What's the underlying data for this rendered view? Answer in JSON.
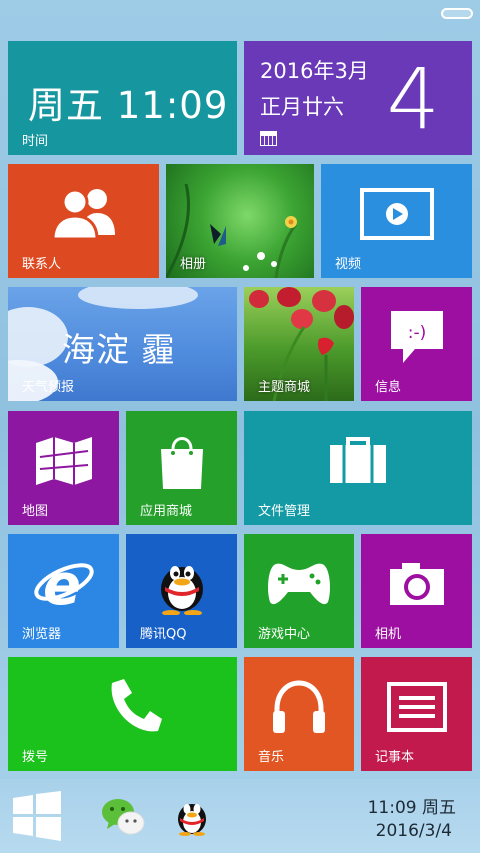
{
  "status_bar": {
    "battery_icon": "battery-icon"
  },
  "tiles": {
    "clock": {
      "time": "周五  11:09",
      "label": "时间",
      "color": "#16969e"
    },
    "calendar": {
      "line1": "2016年3月",
      "line2": "正月廿六",
      "day": "4",
      "icon": "calendar-icon",
      "color": "#6a39b8"
    },
    "contacts": {
      "label": "联系人",
      "icon": "contacts-icon",
      "color": "#dd4a22"
    },
    "album": {
      "label": "相册",
      "color": "#2f9a2a"
    },
    "video": {
      "label": "视频",
      "icon": "video-play-icon",
      "color": "#2a8fdf"
    },
    "weather": {
      "city": "海淀  霾",
      "label": "天气预报"
    },
    "theme_store": {
      "label": "主题商城"
    },
    "messages": {
      "label": "信息",
      "emoticon": ":-)",
      "color": "#9c0fa1"
    },
    "maps": {
      "label": "地图",
      "icon": "map-icon",
      "color": "#8d17a0"
    },
    "app_store": {
      "label": "应用商城",
      "icon": "shopping-bag-icon",
      "color": "#24a02b"
    },
    "file_manager": {
      "label": "文件管理",
      "icon": "briefcase-icon",
      "color": "#139aa4"
    },
    "browser": {
      "label": "浏览器",
      "icon": "ie-browser-icon",
      "color": "#2c87e4"
    },
    "qq": {
      "label": "腾讯QQ",
      "icon": "qq-penguin-icon",
      "color": "#1660c8"
    },
    "games": {
      "label": "游戏中心",
      "icon": "game-controller-icon",
      "color": "#21a22b"
    },
    "camera": {
      "label": "相机",
      "icon": "camera-icon",
      "color": "#9d0fa0"
    },
    "dialer": {
      "label": "拨号",
      "icon": "phone-icon",
      "color": "#1cc21c"
    },
    "music": {
      "label": "音乐",
      "icon": "headphones-icon",
      "color": "#e25624"
    },
    "notepad": {
      "label": "记事本",
      "icon": "notepad-icon",
      "color": "#c21a4c"
    }
  },
  "taskbar": {
    "time": "11:09  周五",
    "date": "2016/3/4",
    "start_icon": "windows-logo-icon",
    "apps": [
      "wechat-icon",
      "qq-icon"
    ]
  }
}
